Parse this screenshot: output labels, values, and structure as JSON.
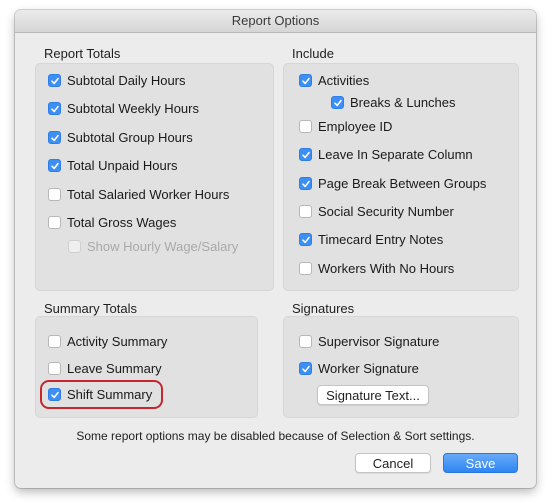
{
  "window": {
    "title": "Report Options"
  },
  "report_totals": {
    "title": "Report Totals",
    "items": [
      {
        "label": "Subtotal Daily Hours",
        "checked": true,
        "disabled": false
      },
      {
        "label": "Subtotal Weekly Hours",
        "checked": true,
        "disabled": false
      },
      {
        "label": "Subtotal Group Hours",
        "checked": true,
        "disabled": false
      },
      {
        "label": "Total Unpaid Hours",
        "checked": true,
        "disabled": false
      },
      {
        "label": "Total Salaried Worker Hours",
        "checked": false,
        "disabled": false
      },
      {
        "label": "Total Gross Wages",
        "checked": false,
        "disabled": false
      },
      {
        "label": "Show Hourly Wage/Salary",
        "checked": false,
        "disabled": true
      }
    ]
  },
  "include": {
    "title": "Include",
    "items": [
      {
        "label": "Activities",
        "checked": true,
        "disabled": false
      },
      {
        "label": "Breaks & Lunches",
        "checked": true,
        "disabled": false
      },
      {
        "label": "Employee ID",
        "checked": false,
        "disabled": false
      },
      {
        "label": "Leave In Separate Column",
        "checked": true,
        "disabled": false
      },
      {
        "label": "Page Break Between Groups",
        "checked": true,
        "disabled": false
      },
      {
        "label": "Social Security Number",
        "checked": false,
        "disabled": false
      },
      {
        "label": "Timecard Entry Notes",
        "checked": true,
        "disabled": false
      },
      {
        "label": "Workers With No Hours",
        "checked": false,
        "disabled": false
      }
    ]
  },
  "summary_totals": {
    "title": "Summary Totals",
    "items": [
      {
        "label": "Activity Summary",
        "checked": false,
        "disabled": false
      },
      {
        "label": "Leave Summary",
        "checked": false,
        "disabled": false
      },
      {
        "label": "Shift Summary",
        "checked": true,
        "disabled": false,
        "highlighted": true
      }
    ]
  },
  "signatures": {
    "title": "Signatures",
    "items": [
      {
        "label": "Supervisor Signature",
        "checked": false,
        "disabled": false
      },
      {
        "label": "Worker Signature",
        "checked": true,
        "disabled": false
      }
    ],
    "signature_text_button": "Signature Text..."
  },
  "footer": {
    "note": "Some report options may be disabled because of Selection & Sort settings.",
    "cancel_label": "Cancel",
    "save_label": "Save"
  },
  "colors": {
    "accent": "#3b8ff5",
    "highlight": "#c8262f"
  }
}
